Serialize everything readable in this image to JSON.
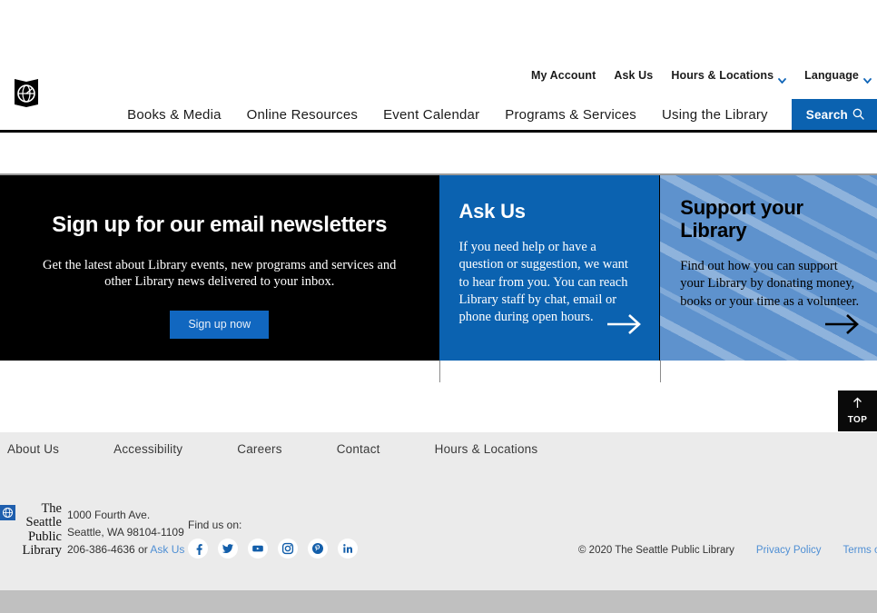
{
  "header": {
    "logo_name": "seattle-public-library-logo",
    "utility_nav": [
      {
        "label": "My Account",
        "has_chevron": false
      },
      {
        "label": "Ask Us",
        "has_chevron": false
      },
      {
        "label": "Hours & Locations",
        "has_chevron": true
      },
      {
        "label": "Language",
        "has_chevron": true
      }
    ],
    "main_nav": [
      {
        "label": "Books & Media"
      },
      {
        "label": "Online Resources"
      },
      {
        "label": "Event Calendar"
      },
      {
        "label": "Programs & Services"
      },
      {
        "label": "Using the Library"
      }
    ],
    "search": {
      "label": "Search",
      "icon": "magnifier-icon"
    }
  },
  "promos": {
    "newsletter": {
      "title": "Sign up for our email newsletters",
      "body": "Get the latest about Library events, new programs and services and other Library news delivered to your inbox.",
      "button": "Sign up now",
      "bg": "#000000",
      "button_bg": "#1167c0"
    },
    "ask_us": {
      "title": "Ask Us",
      "body": "If you need help or have a question or suggestion, we want to hear from you. You can reach Library staff by chat, email or phone during open hours.",
      "arrow": "arrow-right-icon",
      "bg": "#0b62b0"
    },
    "support": {
      "title": "Support your Library",
      "body": "Find out how you can support your Library by donating money, books or your time as a volunteer.",
      "arrow": "arrow-right-icon",
      "bg": "#5e92cd"
    }
  },
  "back_to_top": {
    "label": "TOP",
    "icon": "arrow-up-icon"
  },
  "footer": {
    "links": [
      {
        "label": "About Us"
      },
      {
        "label": "Accessibility"
      },
      {
        "label": "Careers"
      },
      {
        "label": "Contact"
      },
      {
        "label": "Hours & Locations"
      }
    ],
    "brand": {
      "line1": "The",
      "line2": "Seattle",
      "line3": "Public",
      "line4": "Library"
    },
    "address": {
      "street": "1000 Fourth Ave.",
      "city_state_zip": "Seattle, WA 98104-1109",
      "phone": "206-386-4636",
      "or_text": "or",
      "ask_us_link": "Ask Us"
    },
    "social": {
      "label": "Find us on:",
      "items": [
        {
          "name": "facebook-icon"
        },
        {
          "name": "twitter-icon"
        },
        {
          "name": "youtube-icon"
        },
        {
          "name": "instagram-icon"
        },
        {
          "name": "pinterest-icon"
        },
        {
          "name": "linkedin-icon"
        }
      ]
    },
    "copyright": "© 2020 The Seattle Public Library",
    "privacy_policy": "Privacy Policy",
    "terms_of_use": "Terms of Use"
  },
  "colors": {
    "brand_blue": "#0b62b0",
    "light_blue": "#5e92cd",
    "link_blue": "#4f8fd4",
    "footer_bg": "#ebebeb"
  }
}
